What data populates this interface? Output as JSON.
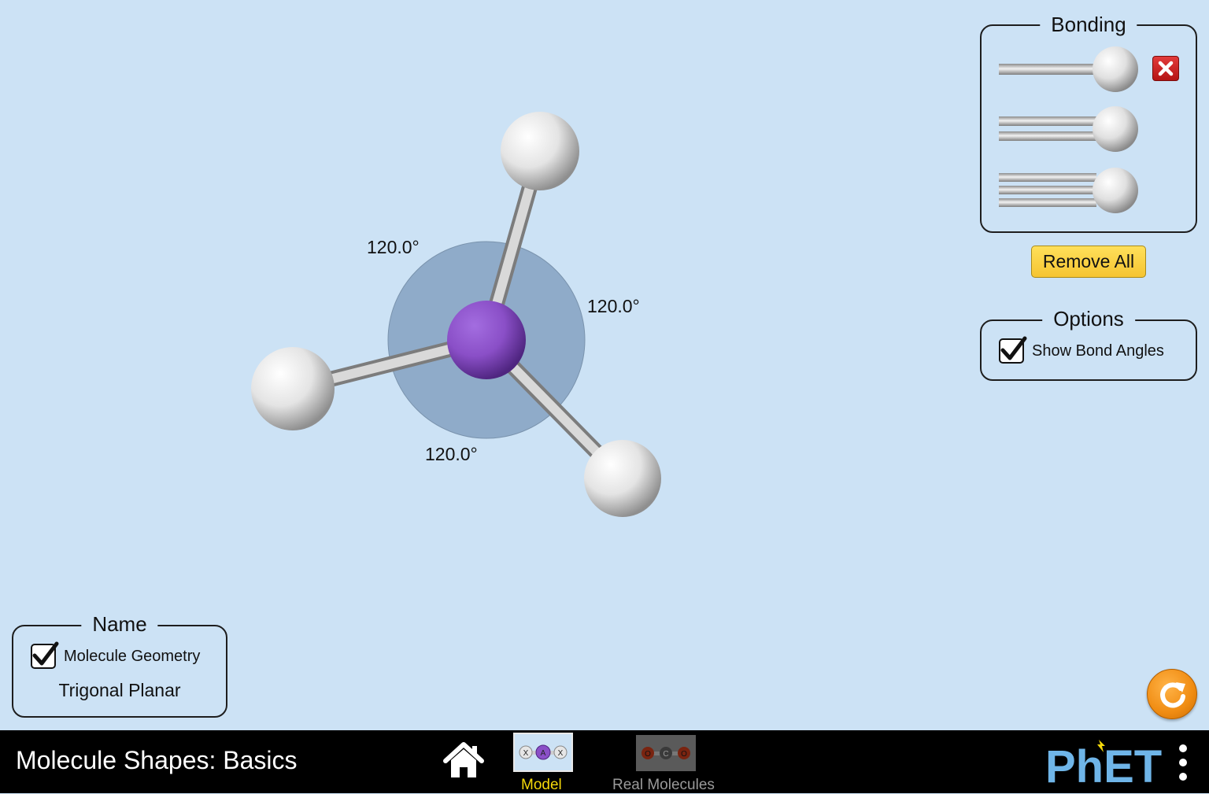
{
  "bonding_panel": {
    "title": "Bonding"
  },
  "remove_all_label": "Remove All",
  "options_panel": {
    "title": "Options",
    "show_bond_angles_label": "Show Bond Angles",
    "show_bond_angles_checked": true
  },
  "name_panel": {
    "title": "Name",
    "molecule_geometry_label": "Molecule Geometry",
    "molecule_geometry_checked": true,
    "geometry_name": "Trigonal Planar"
  },
  "molecule": {
    "bond_angles": [
      "120.0°",
      "120.0°",
      "120.0°"
    ]
  },
  "navbar": {
    "sim_title": "Molecule Shapes: Basics",
    "tabs": [
      {
        "label": "Model",
        "selected": true,
        "icon_atoms": [
          "X",
          "A",
          "X"
        ]
      },
      {
        "label": "Real Molecules",
        "selected": false,
        "icon_atoms": [
          "O",
          "C",
          "O"
        ]
      }
    ],
    "logo_text": "PhET"
  },
  "colors": {
    "background": "#cce2f5",
    "central_atom": "#8a4fc7",
    "selected_tab": "#f5d90a",
    "unselected_tab": "#9a9a9a",
    "button_yellow": "#f5c431",
    "reset_orange": "#f08c12"
  }
}
